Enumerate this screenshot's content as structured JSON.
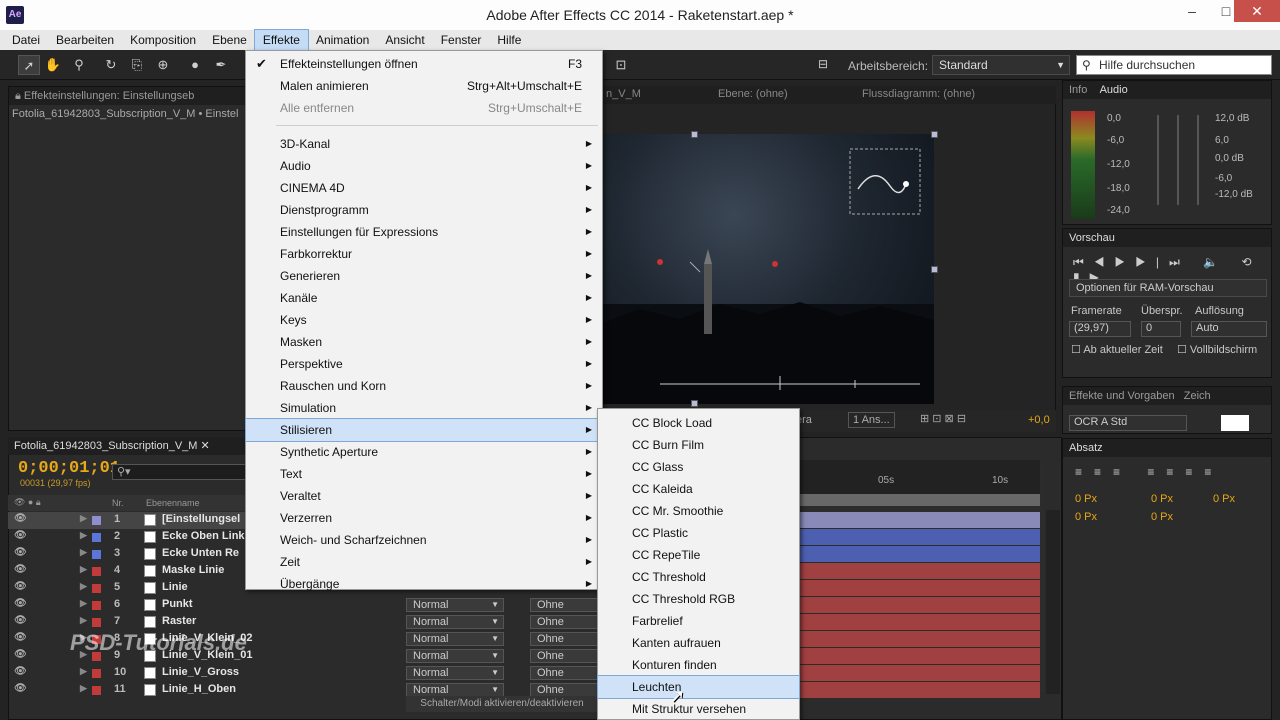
{
  "window": {
    "title": "Adobe After Effects CC 2014 - Raketenstart.aep *",
    "app_icon": "Ae"
  },
  "menubar": [
    "Datei",
    "Bearbeiten",
    "Komposition",
    "Ebene",
    "Effekte",
    "Animation",
    "Ansicht",
    "Fenster",
    "Hilfe"
  ],
  "toolbar": {
    "workspace_label": "Arbeitsbereich:",
    "workspace_value": "Standard",
    "help_placeholder": "Hilfe durchsuchen"
  },
  "effect_controls": {
    "tab": "Effekteinstellungen: Einstellungseb",
    "subtitle": "Fotolia_61942803_Subscription_V_M • Einstel"
  },
  "viewer": {
    "tabs": [
      "n_V_M",
      "Ebene: (ohne)",
      "Flussdiagramm: (ohne)"
    ],
    "controls": [
      "era",
      "1 Ans...",
      "+0,0"
    ]
  },
  "info_panel": {
    "tabs": [
      "Info",
      "Audio"
    ],
    "levels_left": [
      "0,0",
      "-6,0",
      "-12,0",
      "-18,0",
      "-24,0"
    ],
    "levels_right": [
      "12,0 dB",
      "6,0",
      "0,0 dB",
      "-6,0",
      "-12,0 dB"
    ]
  },
  "preview_panel": {
    "tab": "Vorschau",
    "ram_options": "Optionen für RAM-Vorschau",
    "framerate_label": "Framerate",
    "skip_label": "Überspr.",
    "resolution_label": "Auflösung",
    "framerate_value": "(29,97)",
    "skip_value": "0",
    "resolution_value": "Auto",
    "from_current": "Ab aktueller Zeit",
    "fullscreen": "Vollbildschirm"
  },
  "effects_panel": {
    "tabs": [
      "Effekte und Vorgaben",
      "Zeich"
    ],
    "font": "OCR A Std"
  },
  "paragraph_panel": {
    "tab": "Absatz",
    "values": [
      "0 Px",
      "0 Px",
      "0 Px",
      "0 Px",
      "0 Px"
    ]
  },
  "timeline": {
    "tab": "Fotolia_61942803_Subscription_V_M",
    "timecode": "0;00;01;01",
    "fps": "00031 (29,97 fps)",
    "col_nr": "Nr.",
    "col_name": "Ebenenname",
    "ruler": [
      "05s",
      "10s"
    ],
    "bottom_label": "Schalter/Modi aktivieren/deaktivieren",
    "layers": [
      {
        "num": "1",
        "name": "[Einstellungsel",
        "color": "#8f8fd0"
      },
      {
        "num": "2",
        "name": "Ecke Oben Link",
        "color": "#5b76d8"
      },
      {
        "num": "3",
        "name": "Ecke Unten Re",
        "color": "#5b76d8"
      },
      {
        "num": "4",
        "name": "Maske Linie",
        "color": "#c23b3b"
      },
      {
        "num": "5",
        "name": "Linie",
        "color": "#c23b3b"
      },
      {
        "num": "6",
        "name": "Punkt",
        "color": "#c23b3b",
        "mode": "Normal",
        "track": "Ohne"
      },
      {
        "num": "7",
        "name": "Raster",
        "color": "#c23b3b",
        "mode": "Normal",
        "track": "Ohne"
      },
      {
        "num": "8",
        "name": "Linie_V_Klein_02",
        "color": "#c23b3b",
        "mode": "Normal",
        "track": "Ohne"
      },
      {
        "num": "9",
        "name": "Linie_V_Klein_01",
        "color": "#c23b3b",
        "mode": "Normal",
        "track": "Ohne"
      },
      {
        "num": "10",
        "name": "Linie_V_Gross",
        "color": "#c23b3b",
        "mode": "Normal",
        "track": "Ohne"
      },
      {
        "num": "11",
        "name": "Linie_H_Oben",
        "color": "#c23b3b",
        "mode": "Normal",
        "track": "Ohne"
      }
    ]
  },
  "effekte_menu": {
    "top_items": [
      {
        "label": "Effekteinstellungen öffnen",
        "shortcut": "F3",
        "checked": true
      },
      {
        "label": "Malen animieren",
        "shortcut": "Strg+Alt+Umschalt+E"
      },
      {
        "label": "Alle entfernen",
        "shortcut": "Strg+Umschalt+E",
        "disabled": true
      }
    ],
    "categories": [
      "3D-Kanal",
      "Audio",
      "CINEMA 4D",
      "Dienstprogramm",
      "Einstellungen für Expressions",
      "Farbkorrektur",
      "Generieren",
      "Kanäle",
      "Keys",
      "Masken",
      "Perspektive",
      "Rauschen und Korn",
      "Simulation",
      "Stilisieren",
      "Synthetic Aperture",
      "Text",
      "Veraltet",
      "Verzerren",
      "Weich- und Scharfzeichnen",
      "Zeit",
      "Übergänge"
    ],
    "highlighted": "Stilisieren"
  },
  "stilisieren_menu": {
    "items": [
      "CC Block Load",
      "CC Burn Film",
      "CC Glass",
      "CC Kaleida",
      "CC Mr. Smoothie",
      "CC Plastic",
      "CC RepeTile",
      "CC Threshold",
      "CC Threshold RGB",
      "Farbrelief",
      "Kanten aufrauen",
      "Konturen finden",
      "Leuchten",
      "Mit Struktur versehen"
    ],
    "highlighted": "Leuchten"
  },
  "watermark": "PSD-Tutorials.de"
}
